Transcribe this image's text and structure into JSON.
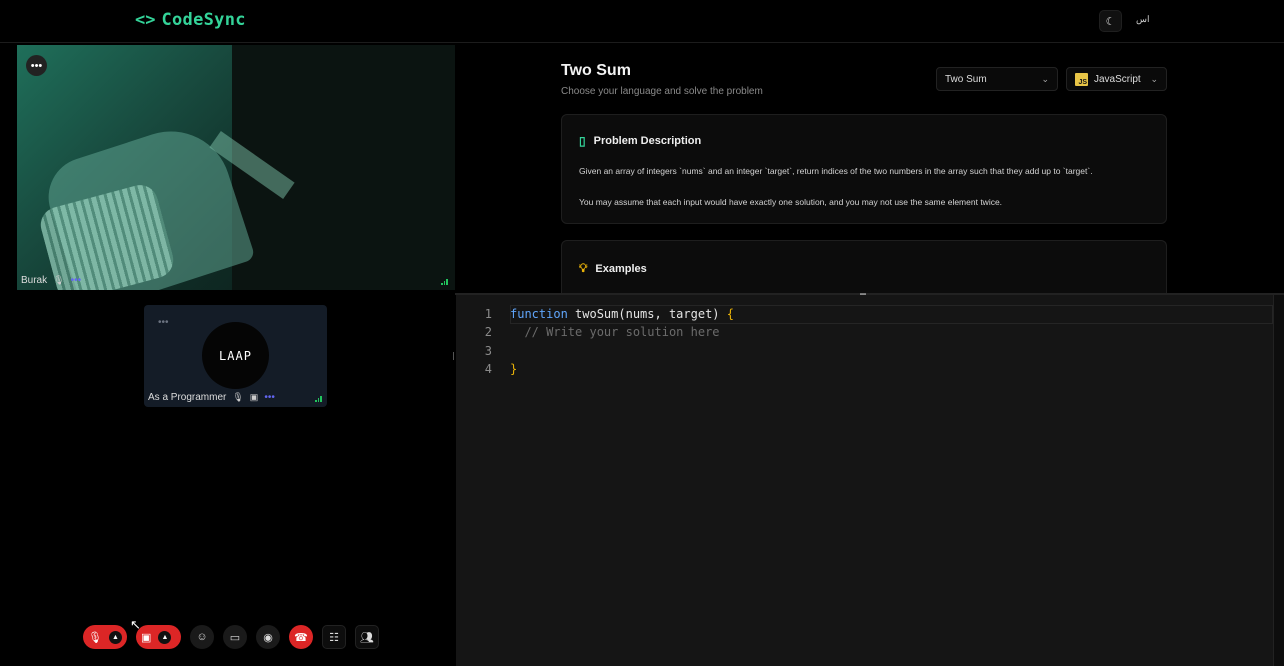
{
  "app": {
    "name": "CodeSync",
    "logo_glyph": "<>",
    "user_mark": "اس"
  },
  "header": {
    "theme_icon": "moon-icon"
  },
  "video": {
    "main": {
      "name": "Burak"
    },
    "secondary": {
      "name": "As a Programmer",
      "avatar_text": "LAAP"
    }
  },
  "problem": {
    "title": "Two Sum",
    "subtitle": "Choose your language and solve the problem",
    "problem_select": "Two Sum",
    "language_select": "JavaScript",
    "language_badge": "JS",
    "description_heading": "Problem Description",
    "description_p1": "Given an array of integers `nums` and an integer `target`, return indices of the two numbers in the array such that they add up to `target`.",
    "description_p2": "You may assume that each input would have exactly one solution, and you may not use the same element twice.",
    "examples_heading": "Examples"
  },
  "editor": {
    "lines": [
      "1",
      "2",
      "3",
      "4"
    ],
    "code": {
      "l1_kw": "function",
      "l1_fn": " twoSum(nums, target) ",
      "l1_br": "{",
      "l2": "  // Write your solution here",
      "l4": "}"
    }
  },
  "controls": [
    "mic-off-icon",
    "camera-off-icon",
    "emoji-icon",
    "screen-share-icon",
    "record-icon",
    "end-call-icon",
    "participants-list-icon",
    "people-icon"
  ],
  "colors": {
    "accent": "#34d399",
    "danger": "#dc2626",
    "keyword": "#60a5fa",
    "bracket": "#eab308"
  }
}
